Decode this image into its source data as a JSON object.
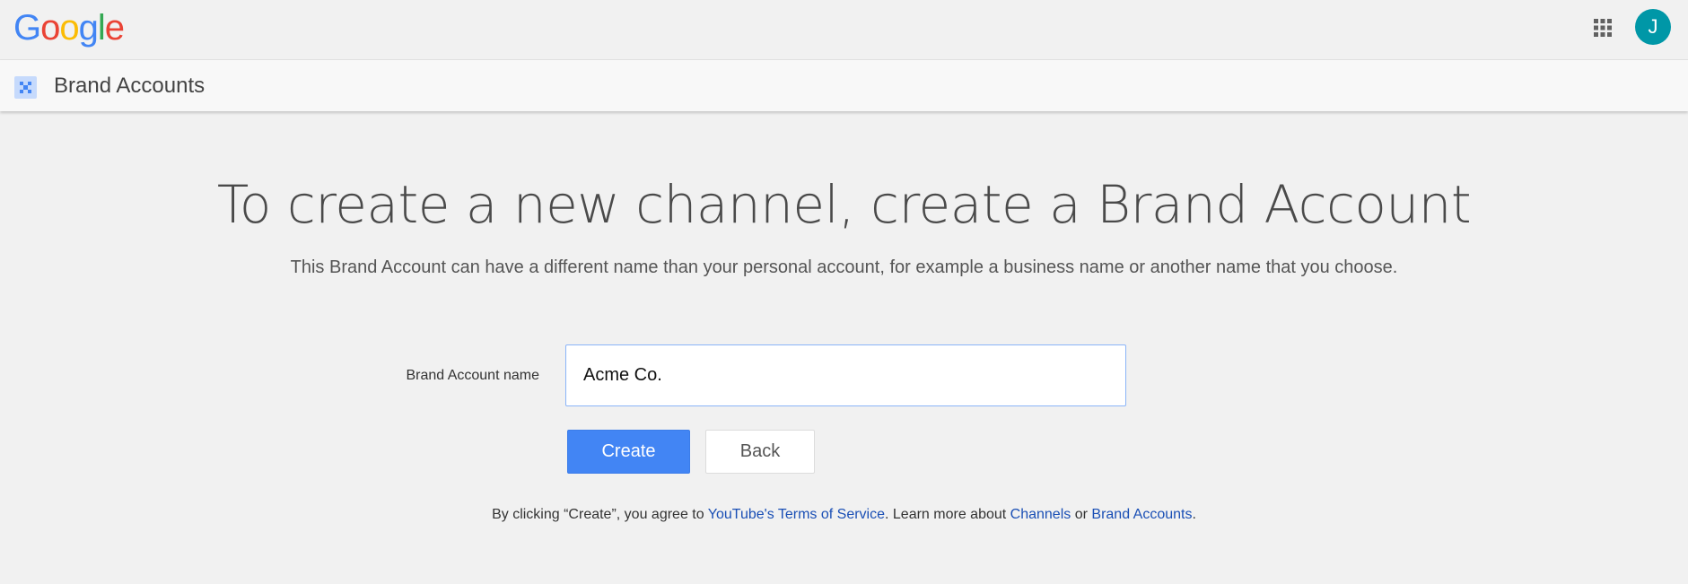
{
  "header": {
    "logo_letters": [
      {
        "char": "G",
        "color": "#4285F4"
      },
      {
        "char": "o",
        "color": "#EA4335"
      },
      {
        "char": "o",
        "color": "#FBBC05"
      },
      {
        "char": "g",
        "color": "#4285F4"
      },
      {
        "char": "l",
        "color": "#34A853"
      },
      {
        "char": "e",
        "color": "#EA4335"
      }
    ],
    "apps_icon": "apps-grid-icon",
    "avatar_initial": "J",
    "avatar_color": "#0097A7"
  },
  "subheader": {
    "icon": "brand-accounts-icon",
    "title": "Brand Accounts"
  },
  "main": {
    "headline": "To create a new channel, create a Brand Account",
    "description": "This Brand Account can have a different name than your personal account, for example a business name or another name that you choose.",
    "field_label": "Brand Account name",
    "field_value": "Acme Co.",
    "create_label": "Create",
    "back_label": "Back",
    "accent_color": "#4285F4"
  },
  "legal": {
    "prefix": "By clicking “Create”, you agree to ",
    "tos_link": "YouTube's Terms of Service",
    "middle": ". Learn more about ",
    "channels_link": "Channels",
    "or": " or ",
    "brand_link": "Brand Accounts",
    "suffix": "."
  }
}
